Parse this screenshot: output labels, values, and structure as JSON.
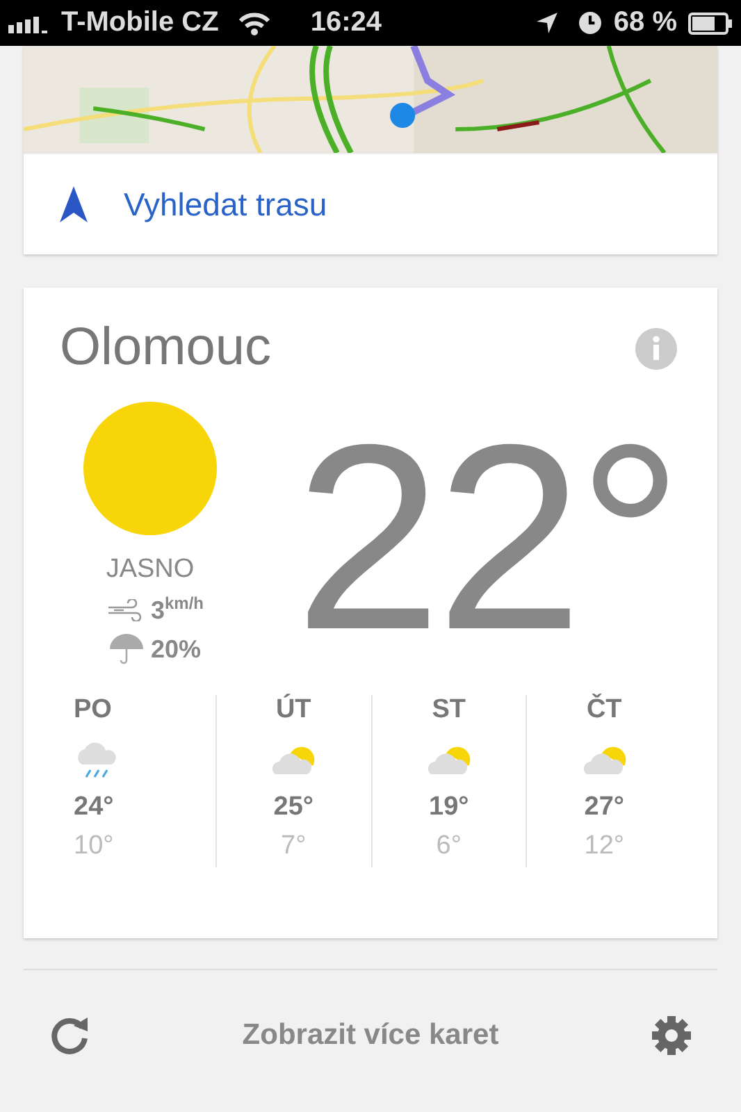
{
  "status_bar": {
    "carrier": "T-Mobile CZ",
    "time": "16:24",
    "battery": "68 %"
  },
  "route_button": {
    "label": "Vyhledat trasu"
  },
  "weather": {
    "city": "Olomouc",
    "temperature": "22°",
    "condition": "JASNO",
    "wind": "3",
    "wind_unit": "km/h",
    "precipitation": "20%",
    "forecast": [
      {
        "day": "PO",
        "kind": "rain",
        "high": "24°",
        "low": "10°"
      },
      {
        "day": "ÚT",
        "kind": "partly_cloudy",
        "high": "25°",
        "low": "7°"
      },
      {
        "day": "ST",
        "kind": "partly_cloudy",
        "high": "19°",
        "low": "6°"
      },
      {
        "day": "ČT",
        "kind": "partly_cloudy",
        "high": "27°",
        "low": "12°"
      }
    ]
  },
  "footer": {
    "label": "Zobrazit více karet"
  }
}
